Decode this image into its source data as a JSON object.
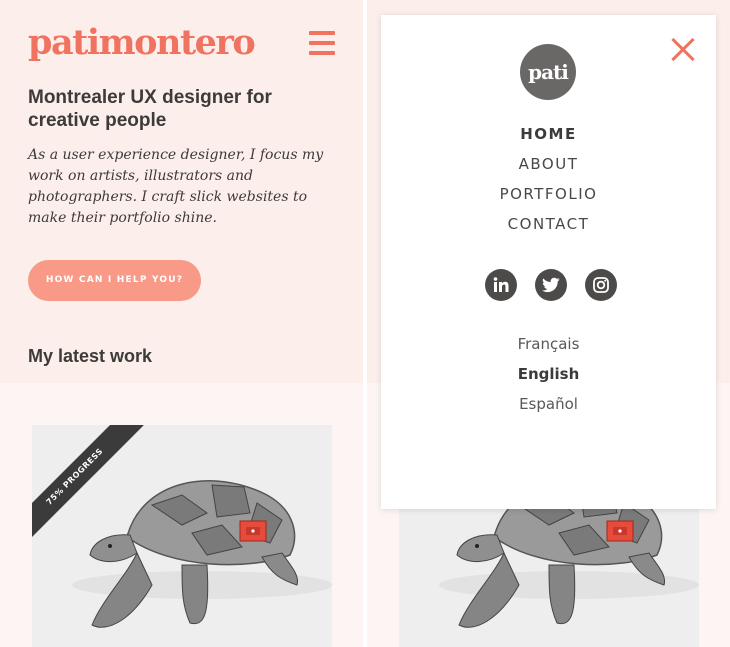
{
  "left": {
    "logo": "patimontero",
    "headline": "Montrealer UX designer for creative people",
    "intro": "As a user experience designer, I focus my work on artists, illustrators and photographers. I craft slick websites to make their portfolio shine.",
    "cta_label": "HOW CAN I HELP YOU?",
    "section_title": "My latest work",
    "ribbon": "75% PROGRESS"
  },
  "menu": {
    "logo": "pati",
    "nav": [
      {
        "label": "HOME",
        "active": true
      },
      {
        "label": "ABOUT",
        "active": false
      },
      {
        "label": "PORTFOLIO",
        "active": false
      },
      {
        "label": "CONTACT",
        "active": false
      }
    ],
    "socials": [
      "linkedin-icon",
      "twitter-icon",
      "instagram-icon"
    ],
    "languages": [
      {
        "label": "Français",
        "active": false
      },
      {
        "label": "English",
        "active": true
      },
      {
        "label": "Español",
        "active": false
      }
    ]
  },
  "colors": {
    "accent": "#f07260",
    "cta": "#f89a87",
    "text": "#3d3a3a",
    "background": "#fcefeb"
  }
}
